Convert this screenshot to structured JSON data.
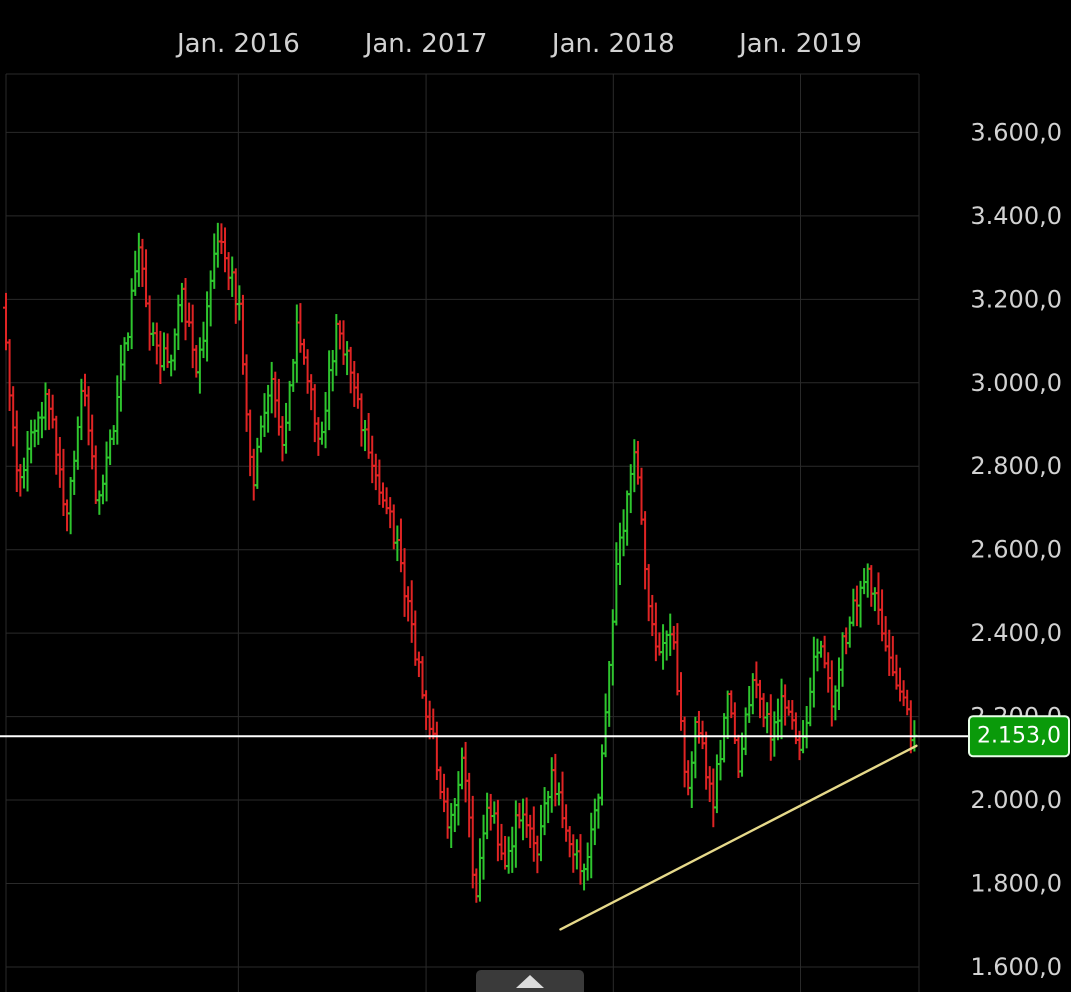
{
  "chart_data": {
    "type": "ohlc",
    "x_tick_labels": [
      "Jan. 2016",
      "Jan. 2017",
      "Jan. 2018",
      "Jan. 2019"
    ],
    "x_ticks": [
      "2016-01-01",
      "2017-01-01",
      "2018-01-01",
      "2019-01-01"
    ],
    "xlim": [
      "2014-10-05",
      "2019-08-20"
    ],
    "y_tick_labels": [
      "1.600,0",
      "1.800,0",
      "2.000,0",
      "2.200,0",
      "2.400,0",
      "2.600,0",
      "2.800,0",
      "3.000,0",
      "3.200,0",
      "3.400,0",
      "3.600,0"
    ],
    "y_ticks": [
      1600,
      1800,
      2000,
      2200,
      2400,
      2600,
      2800,
      3000,
      3200,
      3400,
      3600
    ],
    "ylim": [
      1540,
      3740
    ],
    "grid": true,
    "colors": {
      "up": "#2ec52e",
      "down": "#e02424",
      "trendline": "#e6d98a",
      "current_line": "#ffffff",
      "badge": "#0a9a0a",
      "background": "#000000"
    },
    "current_price": {
      "value": 2153,
      "label": "2.153,0"
    },
    "trendline": {
      "start": {
        "date": "2017-09-20",
        "price": 1690
      },
      "end": {
        "date": "2019-08-15",
        "price": 2130
      }
    },
    "path_points": [
      [
        "2014-10-05",
        3180
      ],
      [
        "2014-11-05",
        2780
      ],
      [
        "2015-01-01",
        2980
      ],
      [
        "2015-02-05",
        2680
      ],
      [
        "2015-03-10",
        2990
      ],
      [
        "2015-04-10",
        2700
      ],
      [
        "2015-05-15",
        2950
      ],
      [
        "2015-07-01",
        3330
      ],
      [
        "2015-07-20",
        3100
      ],
      [
        "2015-08-30",
        3030
      ],
      [
        "2015-09-20",
        3220
      ],
      [
        "2015-10-20",
        3030
      ],
      [
        "2015-12-01",
        3370
      ],
      [
        "2016-01-10",
        3180
      ],
      [
        "2016-02-05",
        2760
      ],
      [
        "2016-03-10",
        3020
      ],
      [
        "2016-04-01",
        2830
      ],
      [
        "2016-05-01",
        3120
      ],
      [
        "2016-06-15",
        2870
      ],
      [
        "2016-07-20",
        3150
      ],
      [
        "2016-08-25",
        2950
      ],
      [
        "2016-10-01",
        2800
      ],
      [
        "2016-11-10",
        2620
      ],
      [
        "2016-12-15",
        2380
      ],
      [
        "2017-01-20",
        2150
      ],
      [
        "2017-02-20",
        1920
      ],
      [
        "2017-03-20",
        2100
      ],
      [
        "2017-04-15",
        1760
      ],
      [
        "2017-05-10",
        2000
      ],
      [
        "2017-06-10",
        1830
      ],
      [
        "2017-07-10",
        1980
      ],
      [
        "2017-08-10",
        1860
      ],
      [
        "2017-09-10",
        2080
      ],
      [
        "2017-10-10",
        1900
      ],
      [
        "2017-11-10",
        1830
      ],
      [
        "2017-12-15",
        2050
      ],
      [
        "2018-01-15",
        2560
      ],
      [
        "2018-02-20",
        2820
      ],
      [
        "2018-03-20",
        2460
      ],
      [
        "2018-04-10",
        2340
      ],
      [
        "2018-05-01",
        2420
      ],
      [
        "2018-06-01",
        2030
      ],
      [
        "2018-06-20",
        2200
      ],
      [
        "2018-07-20",
        1980
      ],
      [
        "2018-08-20",
        2260
      ],
      [
        "2018-09-10",
        2080
      ],
      [
        "2018-10-10",
        2320
      ],
      [
        "2018-11-10",
        2150
      ],
      [
        "2018-12-10",
        2250
      ],
      [
        "2019-01-10",
        2120
      ],
      [
        "2019-02-10",
        2380
      ],
      [
        "2019-03-10",
        2250
      ],
      [
        "2019-04-10",
        2420
      ],
      [
        "2019-05-20",
        2530
      ],
      [
        "2019-06-20",
        2380
      ],
      [
        "2019-07-20",
        2250
      ],
      [
        "2019-08-15",
        2153
      ]
    ]
  },
  "ui": {
    "pull_up_handle_icon": "chevron-up-icon"
  }
}
